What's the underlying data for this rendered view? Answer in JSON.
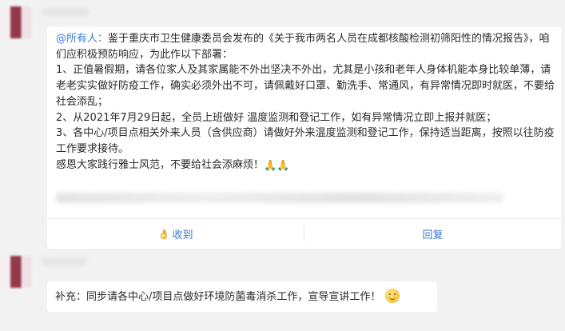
{
  "message1": {
    "mention": "@所有人：",
    "lines": [
      "鉴于重庆市卫生健康委员会发布的《关于我市两名人员在成都核酸检测初筛阳性的情况报告》，咱们应积极预防响应，为此作以下部署：",
      "1、正值暑假期，请各位家人及其家属能不外出坚决不外出，尤其是小孩和老年人身体机能本身比较单薄，请老老实实做好防疫工作，确实必须外出不可，请佩戴好口罩、勤洗手、常通风，有异常情况即时就医，不要给社会添乱；",
      "2、从2021年7月29日起，全员上班做好 温度监测和登记工作，如有异常情况立即上报并就医；",
      "3、各中心/项目点相关外来人员（含供应商）请做好外来温度监测和登记工作，保持适当距离，按照以往防疫工作要求接待。",
      "感恩大家践行雅士风范，不要给社会添麻烦！"
    ],
    "closing_emoji": "🙏🙏",
    "actions": {
      "received_label": "收到",
      "reply_label": "回复"
    }
  },
  "message2": {
    "text": "补充：同步请各中心/项目点做好环境防菌毒消杀工作，宣导宣讲工作！"
  },
  "icons": {
    "received": "hand-icon",
    "smile": "smile-icon",
    "pray": "pray-icon"
  }
}
